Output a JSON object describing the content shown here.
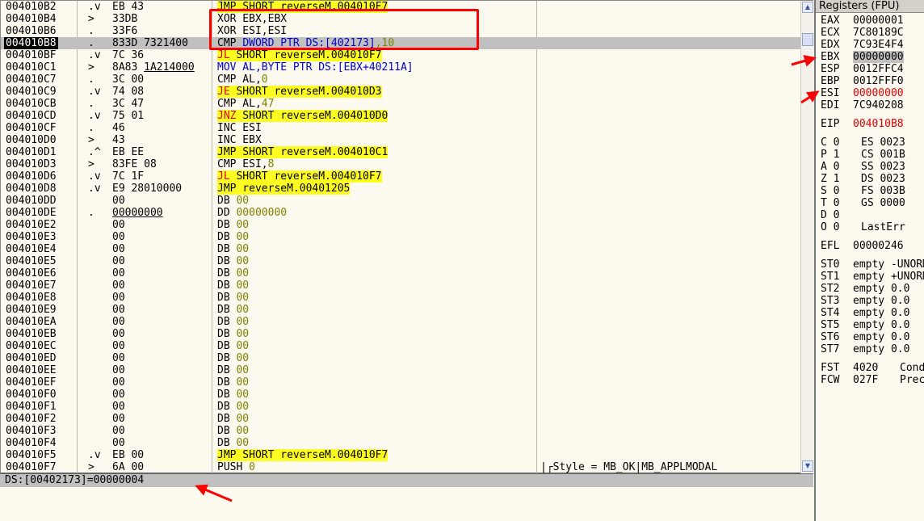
{
  "cpu": {
    "rows": [
      {
        "addr": "004010B2",
        "mark": ".v",
        "hex": "EB 43",
        "dis": [
          {
            "t": "JMP",
            "c": "hl-jmp"
          },
          {
            "t": " SHORT reverseM.004010F7",
            "c": "hl-jmp"
          }
        ],
        "cmt": ""
      },
      {
        "addr": "004010B4",
        "mark": ">",
        "hex": "33DB",
        "dis": [
          {
            "t": "XOR EBX,EBX"
          }
        ],
        "cmt": ""
      },
      {
        "addr": "004010B6",
        "mark": ".",
        "hex": "33F6",
        "dis": [
          {
            "t": "XOR ESI,ESI"
          }
        ],
        "cmt": ""
      },
      {
        "addr": "004010B8",
        "mark": ".",
        "hex": "833D 7321400",
        "dis": [
          {
            "t": "CMP "
          },
          {
            "t": "DWORD PTR DS:[402173]",
            "c": "op-blue"
          },
          {
            "t": ",10",
            "c": "num"
          }
        ],
        "cmt": "",
        "selected": true
      },
      {
        "addr": "004010BF",
        "mark": ".v",
        "hex": "7C 36",
        "dis": [
          {
            "t": "JL",
            "c": "hl-jmp op-red"
          },
          {
            "t": " SHORT reverseM.004010F7",
            "c": "hl-jmp"
          }
        ],
        "cmt": ""
      },
      {
        "addr": "004010C1",
        "mark": ">",
        "hex": "8A83 1A214000",
        "hexul": "1A214000",
        "dis": [
          {
            "t": "MOV AL,BYTE PTR DS:[EBX+40211A]",
            "c": "op-blue"
          }
        ],
        "cmt": ""
      },
      {
        "addr": "004010C7",
        "mark": ".",
        "hex": "3C 00",
        "dis": [
          {
            "t": "CMP AL,"
          },
          {
            "t": "0",
            "c": "num"
          }
        ],
        "cmt": ""
      },
      {
        "addr": "004010C9",
        "mark": ".v",
        "hex": "74 08",
        "dis": [
          {
            "t": "JE",
            "c": "hl-jmp op-red"
          },
          {
            "t": " SHORT reverseM.004010D3",
            "c": "hl-jmp"
          }
        ],
        "cmt": ""
      },
      {
        "addr": "004010CB",
        "mark": ".",
        "hex": "3C 47",
        "dis": [
          {
            "t": "CMP AL,"
          },
          {
            "t": "47",
            "c": "num"
          }
        ],
        "cmt": ""
      },
      {
        "addr": "004010CD",
        "mark": ".v",
        "hex": "75 01",
        "dis": [
          {
            "t": "JNZ",
            "c": "hl-jmp op-red"
          },
          {
            "t": " SHORT reverseM.004010D0",
            "c": "hl-jmp"
          }
        ],
        "cmt": ""
      },
      {
        "addr": "004010CF",
        "mark": ".",
        "hex": "46",
        "dis": [
          {
            "t": "INC ESI"
          }
        ],
        "cmt": ""
      },
      {
        "addr": "004010D0",
        "mark": ">",
        "hex": "43",
        "dis": [
          {
            "t": "INC EBX"
          }
        ],
        "cmt": ""
      },
      {
        "addr": "004010D1",
        "mark": ".^",
        "hex": "EB EE",
        "dis": [
          {
            "t": "JMP",
            "c": "hl-jmp"
          },
          {
            "t": " SHORT reverseM.004010C1",
            "c": "hl-jmp"
          }
        ],
        "cmt": ""
      },
      {
        "addr": "004010D3",
        "mark": ">",
        "hex": "83FE 08",
        "dis": [
          {
            "t": "CMP ESI,"
          },
          {
            "t": "8",
            "c": "num"
          }
        ],
        "cmt": ""
      },
      {
        "addr": "004010D6",
        "mark": ".v",
        "hex": "7C 1F",
        "dis": [
          {
            "t": "JL",
            "c": "hl-jmp op-red"
          },
          {
            "t": " SHORT reverseM.004010F7",
            "c": "hl-jmp"
          }
        ],
        "cmt": ""
      },
      {
        "addr": "004010D8",
        "mark": ".v",
        "hex": "E9 28010000",
        "dis": [
          {
            "t": "JMP",
            "c": "hl-jmp"
          },
          {
            "t": " reverseM.00401205",
            "c": "hl-jmp"
          }
        ],
        "cmt": ""
      },
      {
        "addr": "004010DD",
        "mark": "",
        "hex": "00",
        "dis": [
          {
            "t": "DB "
          },
          {
            "t": "00",
            "c": "num"
          }
        ],
        "cmt": ""
      },
      {
        "addr": "004010DE",
        "mark": ".",
        "hex": "00000000",
        "hexul": "00000000",
        "dis": [
          {
            "t": "DD "
          },
          {
            "t": "00000000",
            "c": "num"
          }
        ],
        "cmt": ""
      },
      {
        "addr": "004010E2",
        "mark": "",
        "hex": "00",
        "dis": [
          {
            "t": "DB "
          },
          {
            "t": "00",
            "c": "num"
          }
        ],
        "cmt": ""
      },
      {
        "addr": "004010E3",
        "mark": "",
        "hex": "00",
        "dis": [
          {
            "t": "DB "
          },
          {
            "t": "00",
            "c": "num"
          }
        ],
        "cmt": ""
      },
      {
        "addr": "004010E4",
        "mark": "",
        "hex": "00",
        "dis": [
          {
            "t": "DB "
          },
          {
            "t": "00",
            "c": "num"
          }
        ],
        "cmt": ""
      },
      {
        "addr": "004010E5",
        "mark": "",
        "hex": "00",
        "dis": [
          {
            "t": "DB "
          },
          {
            "t": "00",
            "c": "num"
          }
        ],
        "cmt": ""
      },
      {
        "addr": "004010E6",
        "mark": "",
        "hex": "00",
        "dis": [
          {
            "t": "DB "
          },
          {
            "t": "00",
            "c": "num"
          }
        ],
        "cmt": ""
      },
      {
        "addr": "004010E7",
        "mark": "",
        "hex": "00",
        "dis": [
          {
            "t": "DB "
          },
          {
            "t": "00",
            "c": "num"
          }
        ],
        "cmt": ""
      },
      {
        "addr": "004010E8",
        "mark": "",
        "hex": "00",
        "dis": [
          {
            "t": "DB "
          },
          {
            "t": "00",
            "c": "num"
          }
        ],
        "cmt": ""
      },
      {
        "addr": "004010E9",
        "mark": "",
        "hex": "00",
        "dis": [
          {
            "t": "DB "
          },
          {
            "t": "00",
            "c": "num"
          }
        ],
        "cmt": ""
      },
      {
        "addr": "004010EA",
        "mark": "",
        "hex": "00",
        "dis": [
          {
            "t": "DB "
          },
          {
            "t": "00",
            "c": "num"
          }
        ],
        "cmt": ""
      },
      {
        "addr": "004010EB",
        "mark": "",
        "hex": "00",
        "dis": [
          {
            "t": "DB "
          },
          {
            "t": "00",
            "c": "num"
          }
        ],
        "cmt": ""
      },
      {
        "addr": "004010EC",
        "mark": "",
        "hex": "00",
        "dis": [
          {
            "t": "DB "
          },
          {
            "t": "00",
            "c": "num"
          }
        ],
        "cmt": ""
      },
      {
        "addr": "004010ED",
        "mark": "",
        "hex": "00",
        "dis": [
          {
            "t": "DB "
          },
          {
            "t": "00",
            "c": "num"
          }
        ],
        "cmt": ""
      },
      {
        "addr": "004010EE",
        "mark": "",
        "hex": "00",
        "dis": [
          {
            "t": "DB "
          },
          {
            "t": "00",
            "c": "num"
          }
        ],
        "cmt": ""
      },
      {
        "addr": "004010EF",
        "mark": "",
        "hex": "00",
        "dis": [
          {
            "t": "DB "
          },
          {
            "t": "00",
            "c": "num"
          }
        ],
        "cmt": ""
      },
      {
        "addr": "004010F0",
        "mark": "",
        "hex": "00",
        "dis": [
          {
            "t": "DB "
          },
          {
            "t": "00",
            "c": "num"
          }
        ],
        "cmt": ""
      },
      {
        "addr": "004010F1",
        "mark": "",
        "hex": "00",
        "dis": [
          {
            "t": "DB "
          },
          {
            "t": "00",
            "c": "num"
          }
        ],
        "cmt": ""
      },
      {
        "addr": "004010F2",
        "mark": "",
        "hex": "00",
        "dis": [
          {
            "t": "DB "
          },
          {
            "t": "00",
            "c": "num"
          }
        ],
        "cmt": ""
      },
      {
        "addr": "004010F3",
        "mark": "",
        "hex": "00",
        "dis": [
          {
            "t": "DB "
          },
          {
            "t": "00",
            "c": "num"
          }
        ],
        "cmt": ""
      },
      {
        "addr": "004010F4",
        "mark": "",
        "hex": "00",
        "dis": [
          {
            "t": "DB "
          },
          {
            "t": "00",
            "c": "num"
          }
        ],
        "cmt": ""
      },
      {
        "addr": "004010F5",
        "mark": ".v",
        "hex": "EB 00",
        "dis": [
          {
            "t": "JMP",
            "c": "hl-jmp"
          },
          {
            "t": " SHORT reverseM.004010F7",
            "c": "hl-jmp"
          }
        ],
        "cmt": ""
      },
      {
        "addr": "004010F7",
        "mark": ">",
        "hex": "6A 00",
        "dis": [
          {
            "t": "PUSH "
          },
          {
            "t": "0",
            "c": "num"
          }
        ],
        "cmt": "|┌Style = MB_OK|MB_APPLMODAL"
      }
    ]
  },
  "info": {
    "line": "DS:[00402173]=00000004"
  },
  "registers": {
    "title": "Registers (FPU)",
    "gp": [
      {
        "name": "EAX",
        "value": "00000001"
      },
      {
        "name": "ECX",
        "value": "7C80189C"
      },
      {
        "name": "EDX",
        "value": "7C93E4F4"
      },
      {
        "name": "EBX",
        "value": "00000000",
        "style": "gray"
      },
      {
        "name": "ESP",
        "value": "0012FFC4"
      },
      {
        "name": "EBP",
        "value": "0012FFF0"
      },
      {
        "name": "ESI",
        "value": "00000000",
        "style": "red"
      },
      {
        "name": "EDI",
        "value": "7C940208"
      }
    ],
    "eip": {
      "name": "EIP",
      "value": "004010B8",
      "style": "red"
    },
    "flags": [
      {
        "f": "C",
        "v": "0",
        "seg": "ES",
        "sv": "0023"
      },
      {
        "f": "P",
        "v": "1",
        "seg": "CS",
        "sv": "001B"
      },
      {
        "f": "A",
        "v": "0",
        "seg": "SS",
        "sv": "0023"
      },
      {
        "f": "Z",
        "v": "1",
        "seg": "DS",
        "sv": "0023"
      },
      {
        "f": "S",
        "v": "0",
        "seg": "FS",
        "sv": "003B"
      },
      {
        "f": "T",
        "v": "0",
        "seg": "GS",
        "sv": "0000"
      },
      {
        "f": "D",
        "v": "0",
        "seg": "",
        "sv": ""
      },
      {
        "f": "O",
        "v": "0",
        "seg": "LastErr",
        "sv": ""
      }
    ],
    "efl": {
      "name": "EFL",
      "value": "00000246"
    },
    "fpu": [
      {
        "name": "ST0",
        "value": "empty -UNORM"
      },
      {
        "name": "ST1",
        "value": "empty +UNORM"
      },
      {
        "name": "ST2",
        "value": "empty 0.0"
      },
      {
        "name": "ST3",
        "value": "empty 0.0"
      },
      {
        "name": "ST4",
        "value": "empty 0.0"
      },
      {
        "name": "ST5",
        "value": "empty 0.0"
      },
      {
        "name": "ST6",
        "value": "empty 0.0"
      },
      {
        "name": "ST7",
        "value": "empty 0.0"
      }
    ],
    "fst": [
      {
        "name": "FST",
        "value": "4020",
        "extra": "Cond"
      },
      {
        "name": "FCW",
        "value": "027F",
        "extra": "Prec"
      }
    ]
  },
  "colors": {
    "annotation": "#ff0000",
    "jump_highlight": "#ffff22",
    "register_changed": "#e00000"
  }
}
